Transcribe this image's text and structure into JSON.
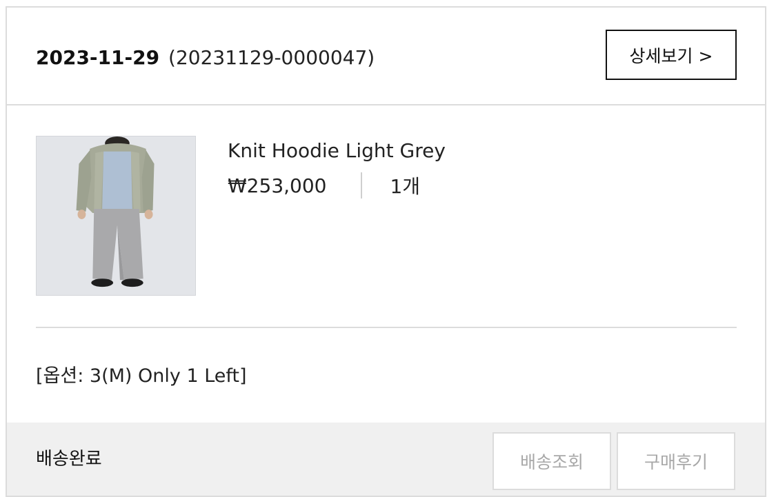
{
  "order": {
    "date": "2023-11-29",
    "number": "(20231129-0000047)",
    "detail_button_label": "상세보기 >"
  },
  "product": {
    "name": "Knit Hoodie Light Grey",
    "price": "₩253,000",
    "quantity": "1개",
    "option": "[옵션: 3(M) Only 1 Left]"
  },
  "footer": {
    "status": "배송완료",
    "tracking_button_label": "배송조회",
    "review_button_label": "구매후기"
  }
}
